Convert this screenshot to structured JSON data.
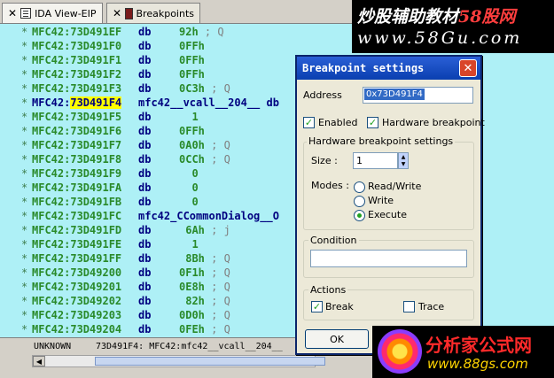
{
  "tabs": [
    {
      "close": "✕",
      "label": "IDA View-EIP"
    },
    {
      "close": "✕",
      "label": "Breakpoints"
    }
  ],
  "lines": [
    {
      "star": "*",
      "addr": "MFC42:73D491EF",
      "ins": "db",
      "opr": "92h",
      "cmt": " ; Q"
    },
    {
      "star": "*",
      "addr": "MFC42:73D491F0",
      "ins": "db",
      "opr": "0FFh",
      "cmt": ""
    },
    {
      "star": "*",
      "addr": "MFC42:73D491F1",
      "ins": "db",
      "opr": "0FFh",
      "cmt": ""
    },
    {
      "star": "*",
      "addr": "MFC42:73D491F2",
      "ins": "db",
      "opr": "0FFh",
      "cmt": ""
    },
    {
      "star": "*",
      "addr": "MFC42:73D491F3",
      "ins": "db",
      "opr": "0C3h",
      "cmt": " ; Q"
    },
    {
      "star": "*",
      "addr_prefix": "MFC42:",
      "addr_hl": "73D491F4",
      "ins_long": "mfc42__vcall__204__ db"
    },
    {
      "star": "*",
      "addr": "MFC42:73D491F5",
      "ins": "db",
      "opr": "  1",
      "cmt": ""
    },
    {
      "star": "*",
      "addr": "MFC42:73D491F6",
      "ins": "db",
      "opr": "0FFh",
      "cmt": ""
    },
    {
      "star": "*",
      "addr": "MFC42:73D491F7",
      "ins": "db",
      "opr": "0A0h",
      "cmt": " ; Q"
    },
    {
      "star": "*",
      "addr": "MFC42:73D491F8",
      "ins": "db",
      "opr": "0CCh",
      "cmt": " ; Q"
    },
    {
      "star": "*",
      "addr": "MFC42:73D491F9",
      "ins": "db",
      "opr": "  0",
      "cmt": ""
    },
    {
      "star": "*",
      "addr": "MFC42:73D491FA",
      "ins": "db",
      "opr": "  0",
      "cmt": ""
    },
    {
      "star": "*",
      "addr": "MFC42:73D491FB",
      "ins": "db",
      "opr": "  0",
      "cmt": ""
    },
    {
      "star": "*",
      "addr": "MFC42:73D491FC",
      "ins_long": "mfc42_CCommonDialog__O"
    },
    {
      "star": "*",
      "addr": "MFC42:73D491FD",
      "ins": "db",
      "opr": " 6Ah",
      "cmt": " ; j"
    },
    {
      "star": "*",
      "addr": "MFC42:73D491FE",
      "ins": "db",
      "opr": "  1",
      "cmt": ""
    },
    {
      "star": "*",
      "addr": "MFC42:73D491FF",
      "ins": "db",
      "opr": " 8Bh",
      "cmt": " ; Q"
    },
    {
      "star": "*",
      "addr": "MFC42:73D49200",
      "ins": "db",
      "opr": "0F1h",
      "cmt": " ; Q"
    },
    {
      "star": "*",
      "addr": "MFC42:73D49201",
      "ins": "db",
      "opr": "0E8h",
      "cmt": " ; Q"
    },
    {
      "star": "*",
      "addr": "MFC42:73D49202",
      "ins": "db",
      "opr": " 82h",
      "cmt": " ; Q"
    },
    {
      "star": "*",
      "addr": "MFC42:73D49203",
      "ins": "db",
      "opr": "0D0h",
      "cmt": " ; Q"
    },
    {
      "star": "*",
      "addr": "MFC42:73D49204",
      "ins": "db",
      "opr": "0FEh",
      "cmt": " ; Q"
    }
  ],
  "status": {
    "mode": "UNKNOWN",
    "location": "73D491F4: MFC42:mfc42__vcall__204__"
  },
  "dialog": {
    "title": "Breakpoint settings",
    "close": "✕",
    "address_label": "Address",
    "address_value": "0x73D491F4",
    "enabled_label": "Enabled",
    "enabled_checked": true,
    "hardware_label": "Hardware breakpoint",
    "hardware_checked": true,
    "hw_group_title": "Hardware breakpoint settings",
    "size_label": "Size :",
    "size_value": "1",
    "modes_label": "Modes :",
    "modes": [
      {
        "label": "Read/Write",
        "selected": false
      },
      {
        "label": "Write",
        "selected": false
      },
      {
        "label": "Execute",
        "selected": true
      }
    ],
    "condition_title": "Condition",
    "condition_value": "",
    "actions_title": "Actions",
    "break_label": "Break",
    "break_checked": true,
    "trace_label": "Trace",
    "trace_checked": false,
    "ok_label": "OK"
  },
  "watermark_top": {
    "line1_a": "炒股辅助教材",
    "line1_b": "58股网",
    "line2": "www.58Gu.com"
  },
  "watermark_bottom": {
    "line1": "分析家公式网",
    "line2": "www.88gs.com"
  }
}
